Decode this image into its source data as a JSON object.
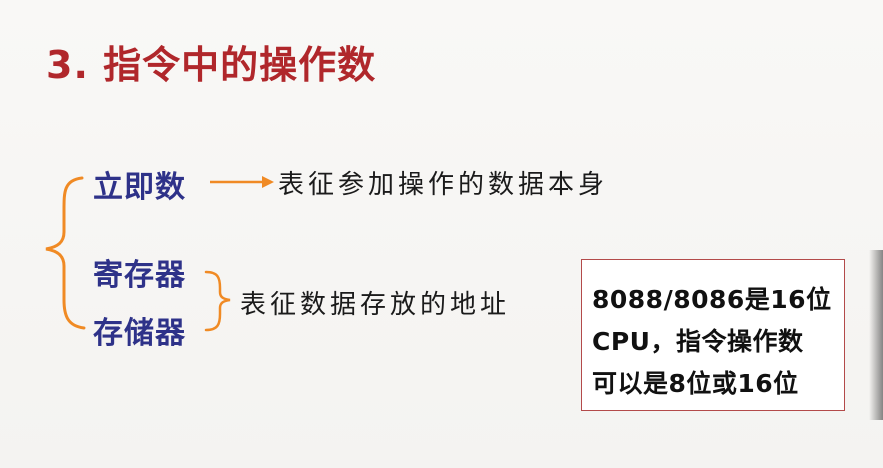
{
  "title": "3. 指令中的操作数",
  "operand_types": [
    {
      "label": "立即数"
    },
    {
      "label": "寄存器"
    },
    {
      "label": "存储器"
    }
  ],
  "descriptions": {
    "immediate": "表征参加操作的数据本身",
    "address": "表征数据存放的地址"
  },
  "note": {
    "lines": [
      "8088/8086是16位",
      "CPU，指令操作数",
      "可以是8位或16位"
    ]
  },
  "colors": {
    "title": "#b0272b",
    "term": "#2e3289",
    "brace": "#f08a24",
    "note_border": "#b34a4a"
  }
}
